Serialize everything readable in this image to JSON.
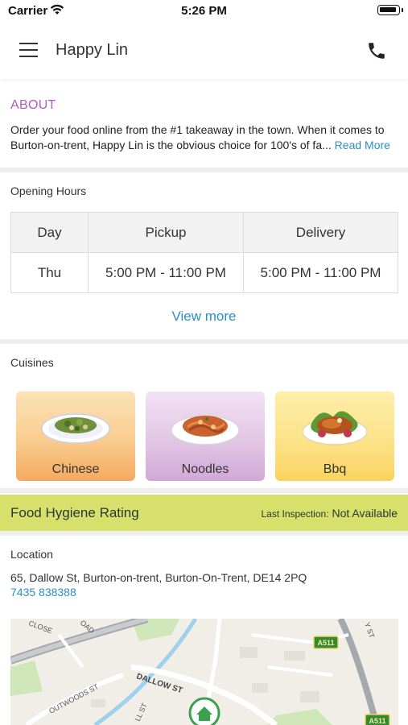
{
  "status_bar": {
    "carrier": "Carrier",
    "time": "5:26 PM"
  },
  "nav": {
    "title": "Happy Lin"
  },
  "about": {
    "heading": "ABOUT",
    "line1": "Order your food online from the #1 takeaway in the town. When it comes to",
    "line2": "Burton-on-trent, Happy Lin is the obvious choice for 100's of fa...",
    "read_more": "Read More"
  },
  "opening_hours": {
    "label": "Opening Hours",
    "columns": [
      "Day",
      "Pickup",
      "Delivery"
    ],
    "rows": [
      {
        "day": "Thu",
        "pickup": "5:00 PM - 11:00 PM",
        "delivery": "5:00 PM - 11:00 PM"
      }
    ],
    "view_more": "View more"
  },
  "cuisines": {
    "label": "Cuisines",
    "items": [
      {
        "name": "Chinese"
      },
      {
        "name": "Noodles"
      },
      {
        "name": "Bbq"
      }
    ]
  },
  "hygiene": {
    "title": "Food Hygiene Rating",
    "last_inspection_label": "Last Inspection:",
    "last_inspection_value": "Not Available",
    "bar_color": "#d6e06a"
  },
  "location": {
    "label": "Location",
    "address": "65, Dallow St, Burton-on-trent, Burton-On-Trent, DE14 2PQ",
    "phone": "7435 838388",
    "map_labels": {
      "close": "CLOSE",
      "road": "OAD",
      "outwoods": "OUTWOODS ST",
      "dallow": "DALLOW ST",
      "st": "LL ST",
      "a511_top": "A511",
      "a511_bottom": "A511",
      "y_st": "Y ST"
    }
  },
  "colors": {
    "accent_purple": "#b259c4",
    "link_blue": "#2c8fc4"
  }
}
